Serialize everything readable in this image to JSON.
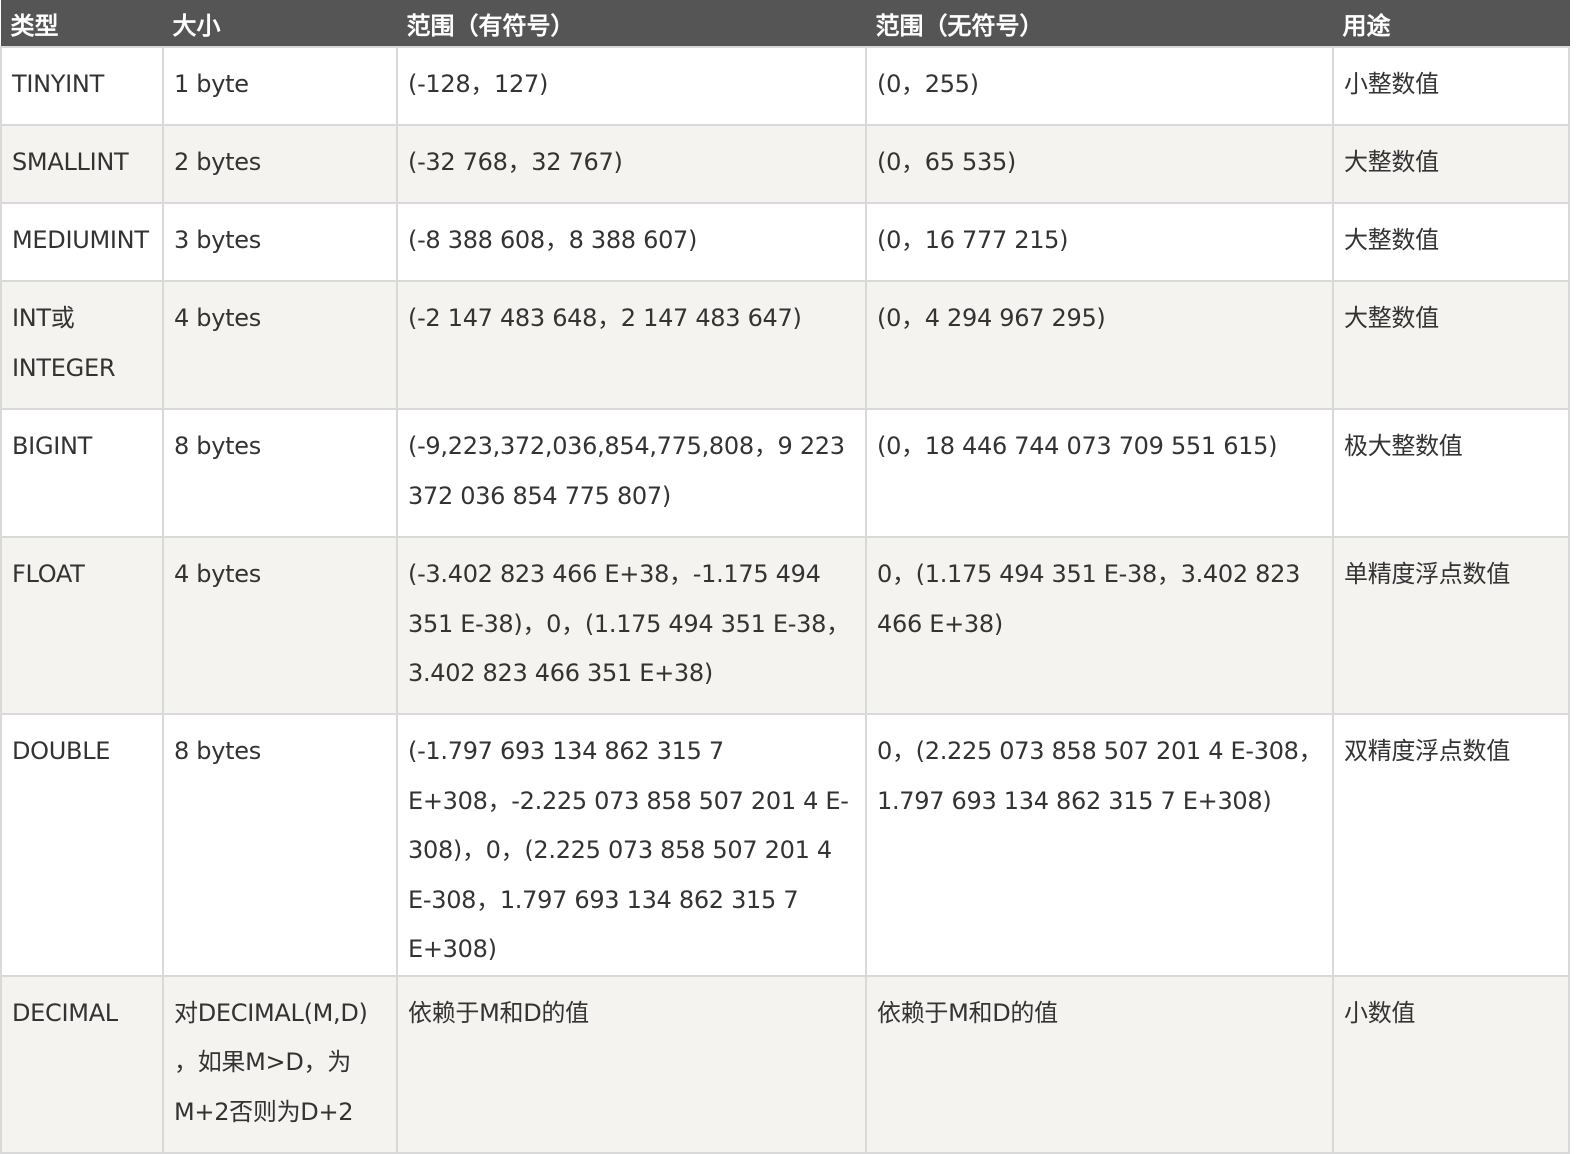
{
  "headers": [
    "类型",
    "大小",
    "范围（有符号）",
    "范围（无符号）",
    "用途"
  ],
  "rows": [
    {
      "type": "TINYINT",
      "size": "1 byte",
      "signed": "(-128，127)",
      "unsigned": "(0，255)",
      "usage": "小整数值"
    },
    {
      "type": "SMALLINT",
      "size": "2 bytes",
      "signed": "(-32 768，32 767)",
      "unsigned": "(0，65 535)",
      "usage": "大整数值"
    },
    {
      "type": "MEDIUMINT",
      "size": "3 bytes",
      "signed": "(-8 388 608，8 388 607)",
      "unsigned": "(0，16 777 215)",
      "usage": "大整数值"
    },
    {
      "type": "INT或INTEGER",
      "size": "4 bytes",
      "signed": "(-2 147 483 648，2 147 483 647)",
      "unsigned": "(0，4 294 967 295)",
      "usage": "大整数值"
    },
    {
      "type": "BIGINT",
      "size": "8 bytes",
      "signed": "(-9,223,372,036,854,775,808，9 223 372 036 854 775 807)",
      "unsigned": "(0，18 446 744 073 709 551 615)",
      "usage": "极大整数值"
    },
    {
      "type": "FLOAT",
      "size": "4 bytes",
      "signed": "(-3.402 823 466 E+38，-1.175 494 351 E-38)，0，(1.175 494 351 E-38，3.402 823 466 351 E+38)",
      "unsigned": "0，(1.175 494 351 E-38，3.402 823 466 E+38)",
      "usage": "单精度浮点数值"
    },
    {
      "type": "DOUBLE",
      "size": "8 bytes",
      "signed": "(-1.797 693 134 862 315 7 E+308，-2.225 073 858 507 201 4 E-308)，0，(2.225 073 858 507 201 4 E-308，1.797 693 134 862 315 7 E+308)",
      "unsigned": "0，(2.225 073 858 507 201 4 E-308，1.797 693 134 862 315 7 E+308)",
      "usage": "双精度浮点数值"
    },
    {
      "type": "DECIMAL",
      "size": "对DECIMAL(M,D) ，如果M>D，为M+2否则为D+2",
      "signed": "依赖于M和D的值",
      "unsigned": "依赖于M和D的值",
      "usage": "小数值"
    }
  ]
}
